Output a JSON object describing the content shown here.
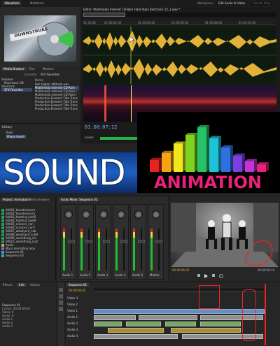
{
  "audition": {
    "tabs": [
      "Waveform",
      "Multitrack"
    ],
    "editor_title": "Editor: Multimedia Internet CD-Rom Flash Bass Electronic 12_1.wav *",
    "workspace_label": "Workspace:",
    "workspace_value": "Edit Audio to Video",
    "search_label": "Search Help",
    "time_display": "01:00:07:12",
    "ruler_ticks": [
      "01:00:00",
      "01:00:02:00",
      "01:00:04:00",
      "01:00:06:00",
      "01:00:08:00",
      "01:00:10:00"
    ],
    "levels_label": "Levels",
    "preview_title": "DOWNSTROKE",
    "media_browser": {
      "tabs": [
        "Media Browser",
        "Files",
        "Markers"
      ],
      "contents_label": "Contents:",
      "contents_value": "SFX Favorites",
      "name_header": "Name",
      "drives": [
        "Volumes",
        "Macintosh HD",
        "Shortcuts",
        "SFX Favorites"
      ],
      "files": [
        "Bell Higher attitude wav",
        "Multimedia Internet CD-Rom",
        "Multimedia Internet CD-Rom F",
        "Multimedia Internet CD-Rom I",
        "Production Element Title Trans",
        "Production Element Title Trans",
        "Production Element Title Trans",
        "Production Element Title Trans"
      ]
    },
    "history_label": "History",
    "history_items": [
      "Open",
      "Phase Invert"
    ]
  },
  "overlay": {
    "sound_text": "SOUND",
    "animation_text": "ANIMATION",
    "bar_colors": [
      "#e8221e",
      "#f5a315",
      "#f0e81c",
      "#7ed321",
      "#25c267",
      "#1dc3d6",
      "#2f6fe0",
      "#7b3fe0",
      "#c234d8",
      "#e8227a"
    ],
    "bar_levels": [
      0.22,
      0.35,
      0.52,
      0.68,
      0.82,
      0.62,
      0.45,
      0.3,
      0.2,
      0.14
    ]
  },
  "premiere": {
    "project_tabs": [
      "Project: Animation",
      "Media Browser"
    ],
    "mixer_tab": "Audio Mixer: Sequence 01",
    "project_items": [
      "00001_thunderstorm",
      "00002_thunderstorm",
      "00003_frosthut_loo05",
      "00004_frosthut_loo06",
      "00005_scissors_con",
      "00006_scissors_con7",
      "00007_woodyard_sub",
      "00008_woodyard_sub9",
      "00009_something_cla",
      "00010_something_cla2",
      "Audio",
      "Moca Animation.mov",
      "Sequence 01",
      "Sequence 02"
    ],
    "mixer_channels": [
      "Audio 1",
      "Audio 2",
      "Audio 3",
      "Audio 4",
      "Audio 5",
      "Master"
    ],
    "program_timecode": "00:00:06:03",
    "program_duration": "00:00:06:10",
    "sequence_tab": "Sequence 01",
    "sequence_timecode": "00:00:06:03",
    "video_tracks": [
      "Video 3",
      "Video 2",
      "Video 1"
    ],
    "audio_tracks": [
      "Audio 1",
      "Audio 2",
      "Audio 3",
      "Audio 4"
    ],
    "info_tabs": [
      "Effects",
      "Info",
      "History"
    ],
    "info_lines": [
      "Sequence 01",
      "Cursor: 00:00:06:03",
      "Video: 0",
      "Audio: 0",
      "Audio 1",
      "Audio 2",
      "Audio 3"
    ]
  }
}
